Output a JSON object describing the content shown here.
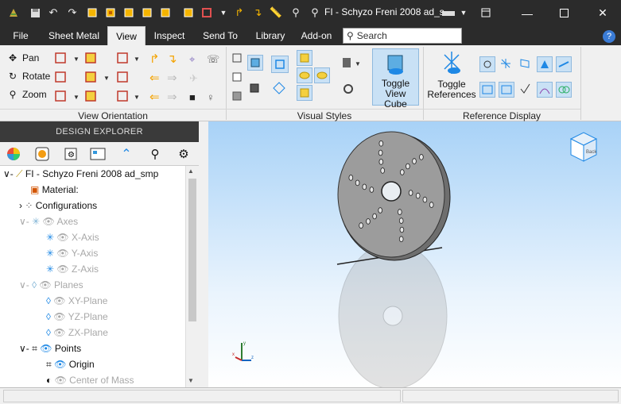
{
  "app": {
    "window_title": "FI - Schyzo Freni 2008 ad_s...",
    "window_controls": [
      "minimize",
      "maximize",
      "close"
    ]
  },
  "menu": {
    "tabs": [
      "File",
      "Sheet Metal",
      "View",
      "Inspect",
      "Send To",
      "Library",
      "Add-on"
    ],
    "active_tab": "View",
    "search_placeholder": "Search",
    "help_label": "?"
  },
  "ribbon": {
    "view_orientation": {
      "label": "View Orientation",
      "pan": "Pan",
      "rotate": "Rotate",
      "zoom": "Zoom"
    },
    "visual_styles": {
      "label": "Visual Styles"
    },
    "toggle_view_cube": {
      "line1": "Toggle",
      "line2": "View Cube"
    },
    "reference_display": {
      "label": "Reference Display",
      "toggle_references_line1": "Toggle",
      "toggle_references_line2": "References"
    }
  },
  "explorer": {
    "title": "DESIGN EXPLORER",
    "tree": [
      {
        "label": "FI - Schyzo Freni 2008 ad_smp",
        "dim": false
      },
      {
        "label": "Material:",
        "dim": false
      },
      {
        "label": "Configurations",
        "dim": false
      },
      {
        "label": "Axes",
        "dim": true
      },
      {
        "label": "X-Axis",
        "dim": true
      },
      {
        "label": "Y-Axis",
        "dim": true
      },
      {
        "label": "Z-Axis",
        "dim": true
      },
      {
        "label": "Planes",
        "dim": true
      },
      {
        "label": "XY-Plane",
        "dim": true
      },
      {
        "label": "YZ-Plane",
        "dim": true
      },
      {
        "label": "ZX-Plane",
        "dim": true
      },
      {
        "label": "Points",
        "dim": false
      },
      {
        "label": "Origin",
        "dim": false
      },
      {
        "label": "Center of Mass",
        "dim": true
      }
    ]
  },
  "viewport": {
    "view_cube_label": "Back",
    "triad": {
      "x": "x",
      "y": "y",
      "z": "z"
    }
  },
  "colors": {
    "chrome_dark": "#2b2b2b",
    "accent_blue": "#1e88e5",
    "viewport_top": "#a8d2f7",
    "viewport_bottom": "#ffffff"
  }
}
